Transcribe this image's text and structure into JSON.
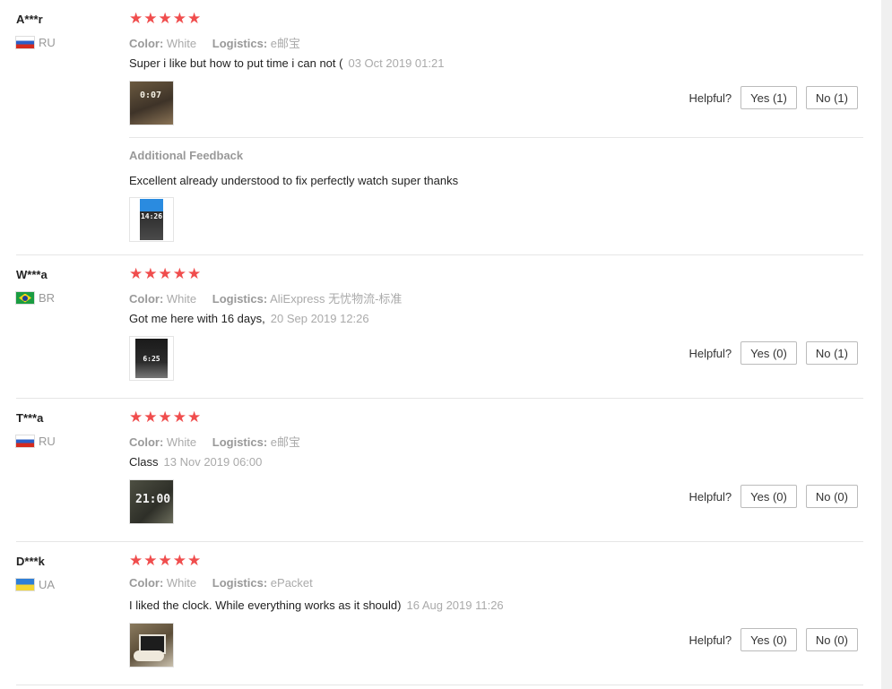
{
  "reviews": [
    {
      "user": "A***r",
      "country": "RU",
      "stars": "★★★★★",
      "color_label": "Color:",
      "color_value": "White",
      "logistics_label": "Logistics:",
      "logistics_value": "e邮宝",
      "text": "Super i like but how to put time i can not (",
      "date": "03 Oct 2019 01:21",
      "thumb_text": "0:07",
      "helpful_label": "Helpful?",
      "yes_label": "Yes (1)",
      "no_label": "No (1)",
      "additional_title": "Additional Feedback",
      "additional_text": "Excellent already understood to fix perfectly watch super thanks",
      "additional_thumb_text": "14:26"
    },
    {
      "user": "W***a",
      "country": "BR",
      "stars": "★★★★★",
      "color_label": "Color:",
      "color_value": "White",
      "logistics_label": "Logistics:",
      "logistics_value": "AliExpress 无忧物流-标准",
      "text": "Got me here with 16 days,",
      "date": "20 Sep 2019 12:26",
      "thumb_text": "6:25",
      "helpful_label": "Helpful?",
      "yes_label": "Yes (0)",
      "no_label": "No (1)"
    },
    {
      "user": "T***a",
      "country": "RU",
      "stars": "★★★★★",
      "color_label": "Color:",
      "color_value": "White",
      "logistics_label": "Logistics:",
      "logistics_value": "e邮宝",
      "text": "Class",
      "date": "13 Nov 2019 06:00",
      "thumb_text": "21:00",
      "helpful_label": "Helpful?",
      "yes_label": "Yes (0)",
      "no_label": "No (0)"
    },
    {
      "user": "D***k",
      "country": "UA",
      "stars": "★★★★★",
      "color_label": "Color:",
      "color_value": "White",
      "logistics_label": "Logistics:",
      "logistics_value": "ePacket",
      "text": "I liked the clock. While everything works as it should)",
      "date": "16 Aug 2019 11:26",
      "thumb_text": "",
      "helpful_label": "Helpful?",
      "yes_label": "Yes (0)",
      "no_label": "No (0)"
    }
  ],
  "colors": {
    "star": "#f04d4d",
    "muted": "#aaaaaa",
    "divider": "#e6e6e6"
  }
}
